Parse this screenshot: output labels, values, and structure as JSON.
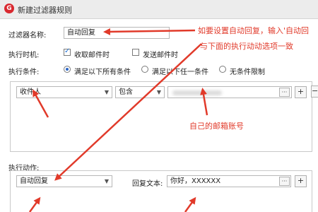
{
  "window": {
    "title": "新建过滤器规则",
    "logo_glyph": "G",
    "logo_color": "#d9282f"
  },
  "filter_name": {
    "label": "过滤器名称:",
    "value": "自动回复"
  },
  "exec_time": {
    "label": "执行时机:",
    "options": [
      {
        "label": "收取邮件时",
        "checked": true
      },
      {
        "label": "发送邮件时",
        "checked": false
      }
    ]
  },
  "exec_condition": {
    "label": "执行条件:",
    "options": [
      {
        "label": "满足以下所有条件",
        "selected": true
      },
      {
        "label": "满足以下任一条件",
        "selected": false
      },
      {
        "label": "无条件限制",
        "selected": false
      }
    ]
  },
  "condition_row": {
    "field": "收件人",
    "operator": "包含",
    "more": "···",
    "add": "+",
    "remove": "−"
  },
  "exec_action": {
    "label": "执行动作:",
    "action": "自动回复",
    "reply_label": "回复文本:",
    "reply_value": "你好，XXXXXX",
    "more": "···",
    "add": "+"
  },
  "annotations": {
    "note1_line1": "如要设置自动回复，输入'自动回",
    "note1_line2": "与下面的执行动动选项一致",
    "note2": "自己的邮箱账号",
    "color": "#e13a2a"
  }
}
